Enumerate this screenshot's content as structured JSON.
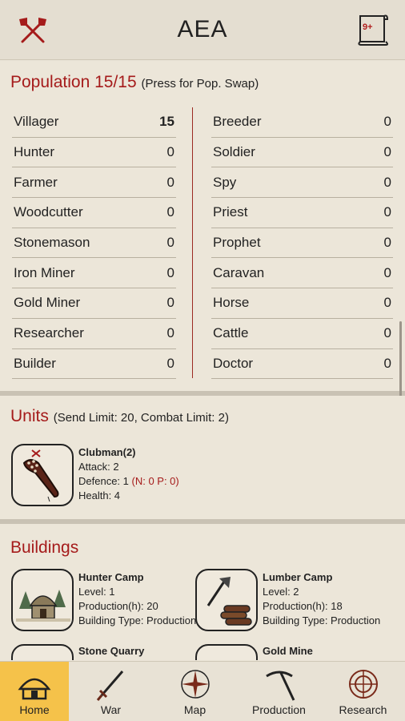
{
  "header": {
    "title": "AEA",
    "left_icon": "crossed-axes-icon",
    "right_icon": "scroll-icon",
    "badge": "9+"
  },
  "population": {
    "title": "Population 15/15",
    "subtitle": "(Press for Pop. Swap)",
    "left": [
      {
        "label": "Villager",
        "value": "15"
      },
      {
        "label": "Hunter",
        "value": "0"
      },
      {
        "label": "Farmer",
        "value": "0"
      },
      {
        "label": "Woodcutter",
        "value": "0"
      },
      {
        "label": "Stonemason",
        "value": "0"
      },
      {
        "label": "Iron Miner",
        "value": "0"
      },
      {
        "label": "Gold Miner",
        "value": "0"
      },
      {
        "label": "Researcher",
        "value": "0"
      },
      {
        "label": "Builder",
        "value": "0"
      }
    ],
    "right": [
      {
        "label": "Breeder",
        "value": "0"
      },
      {
        "label": "Soldier",
        "value": "0"
      },
      {
        "label": "Spy",
        "value": "0"
      },
      {
        "label": "Priest",
        "value": "0"
      },
      {
        "label": "Prophet",
        "value": "0"
      },
      {
        "label": "Caravan",
        "value": "0"
      },
      {
        "label": "Horse",
        "value": "0"
      },
      {
        "label": "Cattle",
        "value": "0"
      },
      {
        "label": "Doctor",
        "value": "0"
      }
    ]
  },
  "units": {
    "title": "Units",
    "subtitle": "(Send Limit: 20, Combat Limit: 2)",
    "items": [
      {
        "name": "Clubman(2)",
        "attack": "Attack: 2",
        "defence": "Defence: 1",
        "defence_extra": "(N: 0 P: 0)",
        "health": "Health: 4"
      }
    ]
  },
  "buildings": {
    "title": "Buildings",
    "items": [
      {
        "name": "Hunter Camp",
        "level": "Level: 1",
        "production": "Production(h): 20",
        "type": "Building Type: Production"
      },
      {
        "name": "Lumber Camp",
        "level": "Level: 2",
        "production": "Production(h): 18",
        "type": "Building Type: Production"
      },
      {
        "name": "Stone Quarry"
      },
      {
        "name": "Gold Mine"
      }
    ]
  },
  "tabs": [
    {
      "label": "Home",
      "icon": "hut-icon",
      "active": true
    },
    {
      "label": "War",
      "icon": "sword-icon"
    },
    {
      "label": "Map",
      "icon": "compass-icon"
    },
    {
      "label": "Production",
      "icon": "pickaxe-icon"
    },
    {
      "label": "Research",
      "icon": "research-icon"
    }
  ],
  "colors": {
    "accent_red": "#a51b1b",
    "active_tab": "#f5c24a",
    "background": "#e9e3d6"
  }
}
